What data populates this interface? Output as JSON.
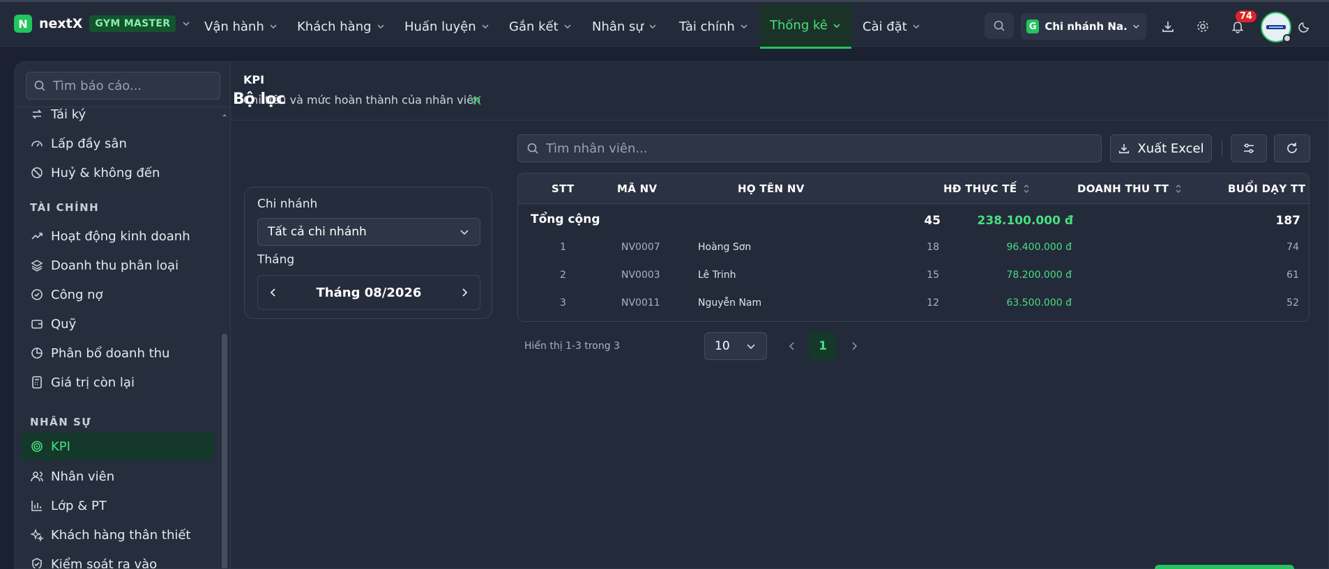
{
  "brand": {
    "logo_letter": "N",
    "name": "nextX",
    "badge": "GYM MASTER"
  },
  "nav": [
    {
      "label": "Vận hành"
    },
    {
      "label": "Khách hàng"
    },
    {
      "label": "Huấn luyện"
    },
    {
      "label": "Gắn kết"
    },
    {
      "label": "Nhân sự"
    },
    {
      "label": "Tài chính"
    },
    {
      "label": "Thống kê",
      "active": true
    },
    {
      "label": "Cài đặt"
    }
  ],
  "topbar": {
    "branch_letter": "G",
    "branch_label": "Chi nhánh Na...",
    "notifications": "74"
  },
  "sidebar": {
    "search_placeholder": "Tìm báo cáo...",
    "items_top": [
      "Tái ký",
      "Lấp đầy sân",
      "Huỷ & không đến"
    ],
    "section_finance": "TÀI CHÍNH",
    "items_finance": [
      "Hoạt động kinh doanh",
      "Doanh thu phân loại",
      "Công nợ",
      "Quỹ",
      "Phân bổ doanh thu",
      "Giá trị còn lại"
    ],
    "section_hr": "NHÂN SỰ",
    "items_hr": [
      "KPI",
      "Nhân viên",
      "Lớp & PT",
      "Khách hàng thân thiết",
      "Kiểm soát ra vào"
    ]
  },
  "page": {
    "title": "KPI",
    "subtitle": "Chỉ tiêu và mức hoàn thành của nhân viên"
  },
  "filter": {
    "title": "Bộ lọc",
    "branch_label": "Chi nhánh",
    "branch_value": "Tất cả chi nhánh",
    "month_label": "Tháng",
    "month_value": "Tháng 08/2026"
  },
  "toolbar": {
    "search_placeholder": "Tìm nhân viên...",
    "export_label": "Xuất Excel"
  },
  "table": {
    "headers": {
      "stt": "STT",
      "code": "MÃ NV",
      "name": "HỌ TÊN NV",
      "contracts": "HĐ THỰC TẾ",
      "revenue": "DOANH THU TT",
      "sessions": "BUỔI DẠY TT"
    },
    "total": {
      "label": "Tổng cộng",
      "contracts": "45",
      "revenue": "238.100.000 đ",
      "sessions": "187"
    },
    "rows": [
      {
        "stt": "1",
        "code": "NV0007",
        "name": "Hoàng Sơn",
        "contracts": "18",
        "revenue": "96.400.000 đ",
        "sessions": "74"
      },
      {
        "stt": "2",
        "code": "NV0003",
        "name": "Lê Trinh",
        "contracts": "15",
        "revenue": "78.200.000 đ",
        "sessions": "61"
      },
      {
        "stt": "3",
        "code": "NV0011",
        "name": "Nguyễn Nam",
        "contracts": "12",
        "revenue": "63.500.000 đ",
        "sessions": "52"
      }
    ]
  },
  "pagination": {
    "info": "Hiển thị 1-3 trong 3",
    "page_size": "10",
    "current_page": "1"
  },
  "colors": {
    "accent": "#22c55e",
    "accent_text": "#4ade80",
    "background": "#1b2130",
    "panel": "#232a3a",
    "badge": "#dc2626"
  }
}
